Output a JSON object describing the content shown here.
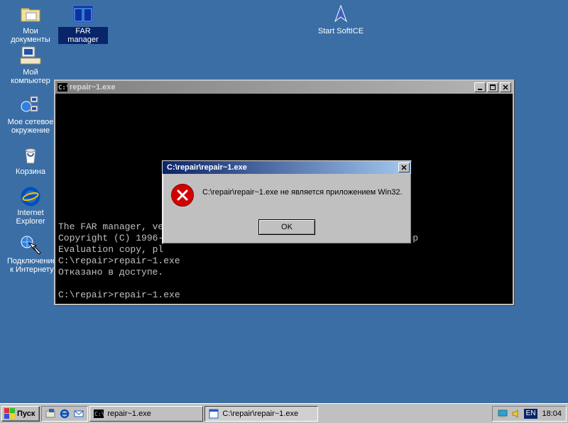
{
  "desktop": {
    "icons": [
      {
        "label": "Мои документы"
      },
      {
        "label": "FAR manager"
      },
      {
        "label": "Start SoftICE"
      },
      {
        "label": "Мой компьютер"
      },
      {
        "label": "Мое сетевое окружение"
      },
      {
        "label": "Корзина"
      },
      {
        "label": "Internet Explorer"
      },
      {
        "label": "Подключение к Интернету"
      }
    ]
  },
  "console": {
    "title": "repair~1.exe",
    "lines": "\n\n\n\n\n\n\n\n\n\n\nThe FAR manager, ve\nCopyright (C) 1996-                                     FAR Group\nEvaluation copy, pl\nC:\\repair>repair~1.exe\nОтказано в доступе.\n\nC:\\repair>repair~1.exe"
  },
  "dialog": {
    "title": "C:\\repair\\repair~1.exe",
    "message": "C:\\repair\\repair~1.exe не является приложением Win32.",
    "ok": "OK"
  },
  "taskbar": {
    "start": "Пуск",
    "task1": "repair~1.exe",
    "task2": "C:\\repair\\repair~1.exe",
    "lang": "EN",
    "clock": "18:04"
  }
}
